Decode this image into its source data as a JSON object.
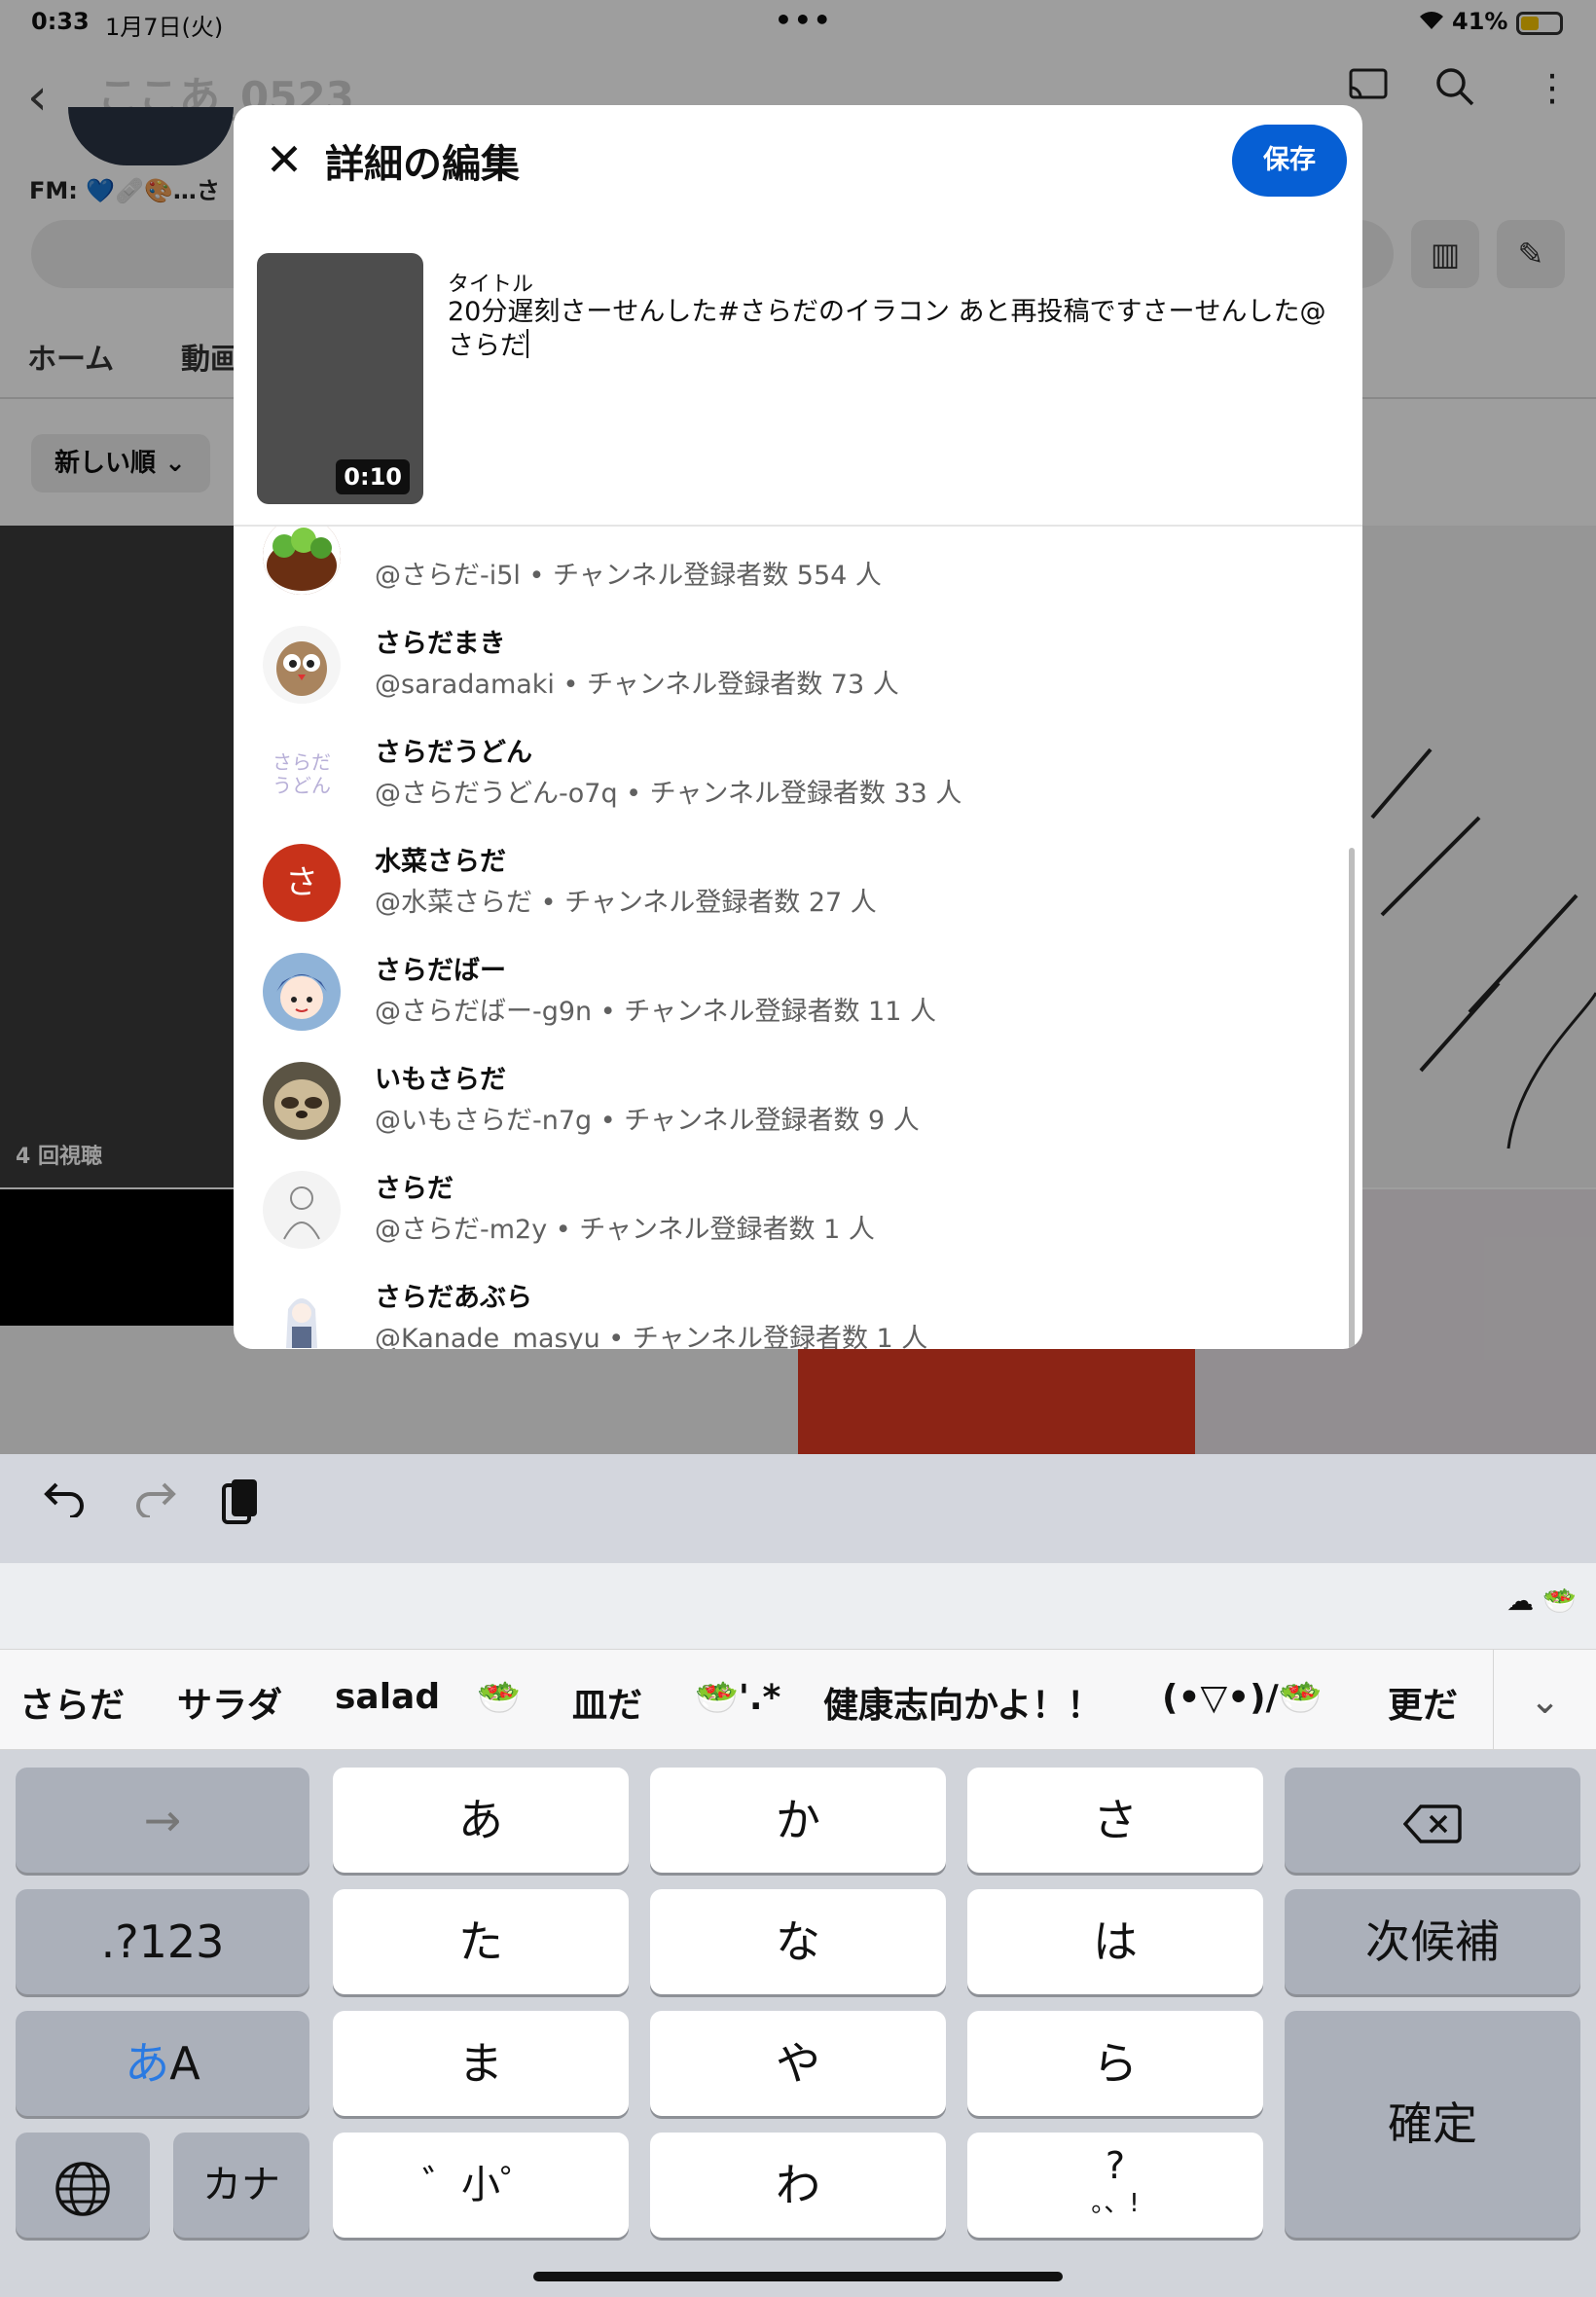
{
  "status_bar": {
    "time": "0:33",
    "date": "1月7日(火)",
    "battery": "41%"
  },
  "background": {
    "channel_name": "ここあ_0523",
    "fm_text": "FM: 💙🩹🎨…さ",
    "tabs": [
      "ホーム",
      "動画"
    ],
    "sort_label": "新しい順",
    "views_label": "4 回視聴"
  },
  "dialog": {
    "title": "詳細の編集",
    "save_label": "保存",
    "video_duration": "0:10",
    "field_label": "タイトル",
    "title_value": "20分遅刻さーせんした#さらだのイラコン あと再投稿ですさーせんした@さらだ",
    "suggestions": [
      {
        "name": "",
        "handle": "@さらだ-i5l • チャンネル登録者数 554 人"
      },
      {
        "name": "さらだまき",
        "handle": "@saradamaki • チャンネル登録者数 73 人"
      },
      {
        "name": "さらだうどん",
        "handle": "@さらだうどん-o7q • チャンネル登録者数 33 人"
      },
      {
        "name": "水菜さらだ",
        "handle": "@水菜さらだ • チャンネル登録者数 27 人",
        "avatar_letter": "さ"
      },
      {
        "name": "さらだばー",
        "handle": "@さらだばー-g9n • チャンネル登録者数 11 人"
      },
      {
        "name": "いもさらだ",
        "handle": "@いもさらだ-n7g • チャンネル登録者数 9 人"
      },
      {
        "name": "さらだ",
        "handle": "@さらだ-m2y • チャンネル登録者数 1 人"
      },
      {
        "name": "さらだあぶら",
        "handle": "@Kanade_masyu • チャンネル登録者数 1 人"
      }
    ],
    "avatar_text_udon": "さらだ うどん"
  },
  "keyboard": {
    "candidates": [
      "さらだ",
      "サラダ",
      "salad",
      "🥗",
      "皿だ",
      "🥗'.*",
      "健康志向かよ！！",
      "(•▽•)/🥗",
      "更だ"
    ],
    "keys": {
      "arrow": "→",
      "a": "あ",
      "ka": "か",
      "sa": "さ",
      "num": ".?123",
      "ta": "た",
      "na": "な",
      "ha": "は",
      "next": "次候補",
      "mode_a": "あ",
      "mode_b": "A",
      "ma": "ま",
      "ya": "や",
      "ra": "ら",
      "confirm": "確定",
      "kana": "カナ",
      "dakuten": "゛小゜",
      "wa": "わ",
      "punct_top": "?",
      "punct_bottom": "。、!"
    }
  },
  "colors": {
    "accent": "#065fd4",
    "avatar_red": "#c8321a"
  }
}
